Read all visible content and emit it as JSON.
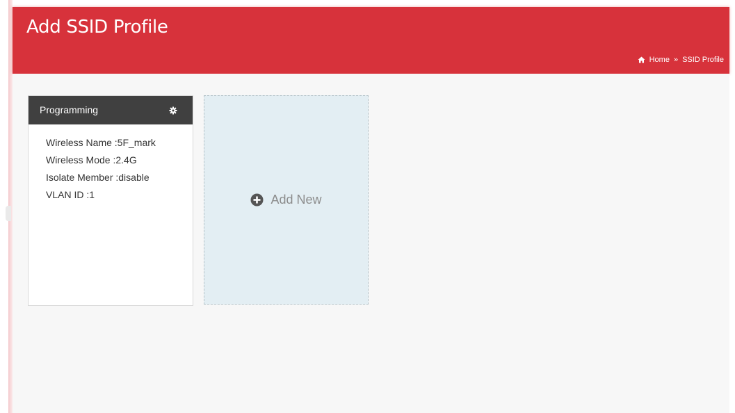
{
  "header": {
    "title": "Add SSID Profile",
    "breadcrumb": {
      "home_icon": "home-icon",
      "home_label": "Home",
      "separator": "»",
      "current": "SSID Profile"
    }
  },
  "profiles": [
    {
      "name": "Programming",
      "settings_icon": "gear-icon",
      "lines": [
        "Wireless Name :5F_mark",
        "Wireless Mode :2.4G",
        "Isolate Member :disable",
        "VLAN ID :1"
      ]
    }
  ],
  "add_new": {
    "icon": "plus-circle-icon",
    "label": "Add New"
  },
  "colors": {
    "header_bg": "#d7323b",
    "card_header_bg": "#404040",
    "add_new_bg": "#e3eef3",
    "content_bg": "#f7f7f7"
  }
}
